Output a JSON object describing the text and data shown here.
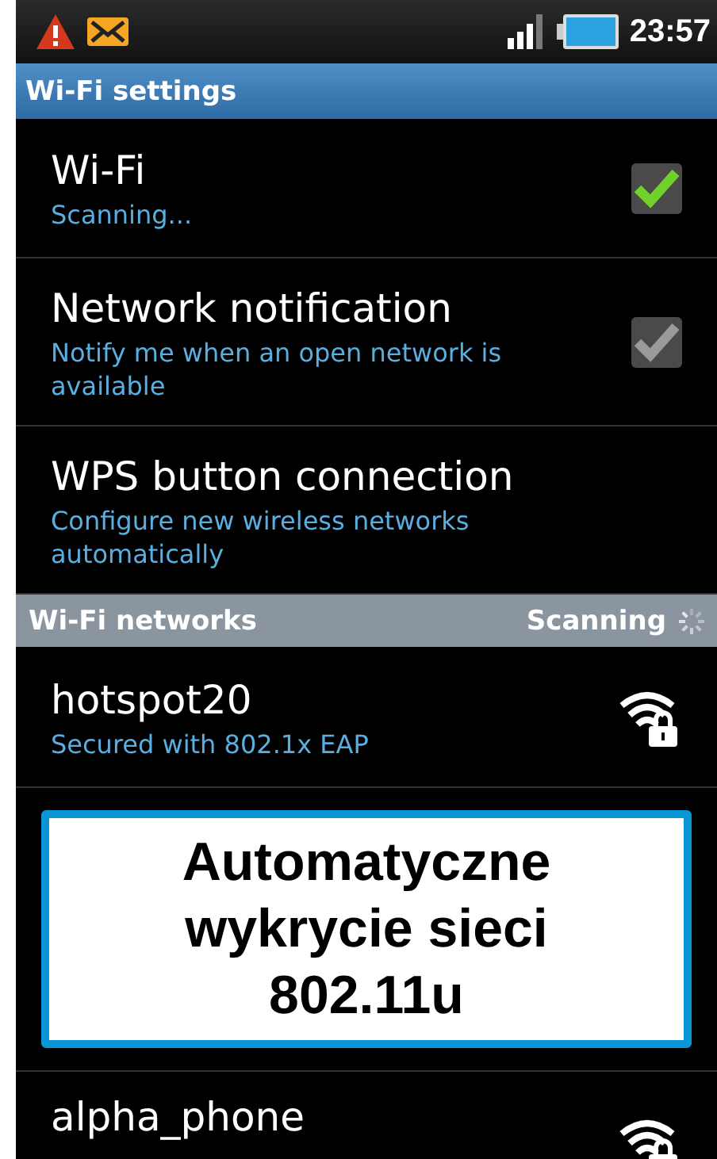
{
  "status_bar": {
    "time": "23:57"
  },
  "header": {
    "title": "Wi-Fi settings"
  },
  "settings": [
    {
      "title": "Wi-Fi",
      "summary": "Scanning...",
      "kind": "checkbox",
      "checked": true,
      "disabled": false
    },
    {
      "title": "Network notification",
      "summary": "Notify me when an open network is available",
      "kind": "checkbox",
      "checked": true,
      "disabled": true
    },
    {
      "title": "WPS button connection",
      "summary": "Configure new wireless networks automatically",
      "kind": "text"
    }
  ],
  "networks_header": {
    "title": "Wi-Fi networks",
    "status": "Scanning"
  },
  "networks": [
    {
      "name": "hotspot20",
      "summary": "Secured with 802.1x EAP"
    }
  ],
  "callout": {
    "lines": [
      "Automatyczne",
      "wykrycie sieci",
      "802.11u"
    ]
  },
  "networks_after": [
    {
      "name": "alpha_phone"
    }
  ]
}
